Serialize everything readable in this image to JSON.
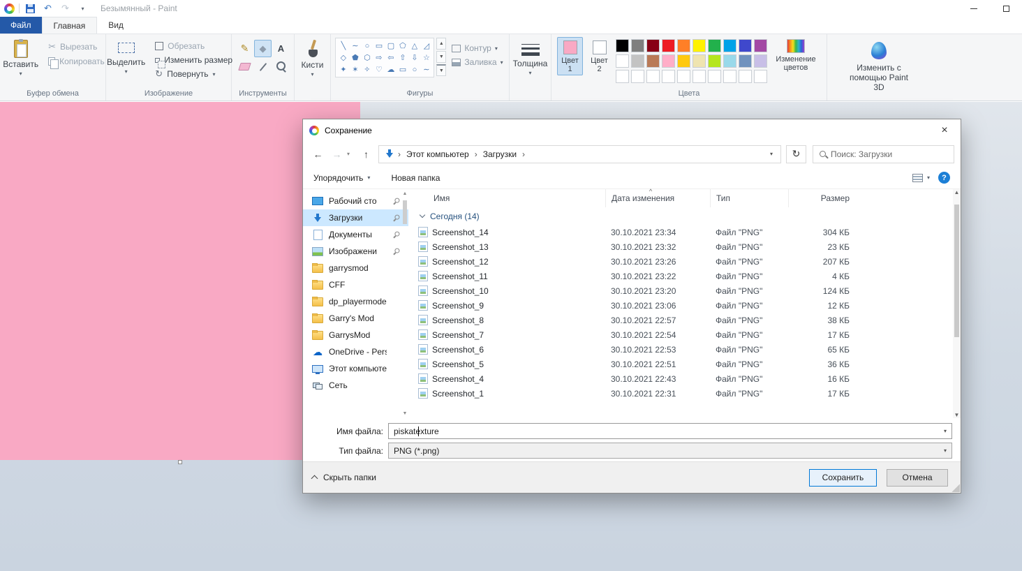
{
  "titlebar": {
    "title": "Безымянный - Paint"
  },
  "tabs": {
    "file": "Файл",
    "home": "Главная",
    "view": "Вид"
  },
  "ribbon": {
    "clipboard": {
      "label": "Буфер обмена",
      "paste": "Вставить",
      "cut": "Вырезать",
      "copy": "Копировать"
    },
    "image": {
      "label": "Изображение",
      "select": "Выделить",
      "crop": "Обрезать",
      "resize": "Изменить размер",
      "rotate": "Повернуть"
    },
    "tools": {
      "label": "Инструменты",
      "items": [
        {
          "icon": "pencil-icon"
        },
        {
          "icon": "fill-icon",
          "selected": true
        },
        {
          "icon": "text-icon"
        },
        {
          "icon": "eraser-icon"
        },
        {
          "icon": "picker-icon"
        },
        {
          "icon": "magnifier-icon"
        }
      ]
    },
    "brushes": {
      "label": "Кисти"
    },
    "shapes": {
      "label": "Фигуры",
      "outline": "Контур",
      "fill": "Заливка",
      "glyphs": [
        "╲",
        "∼",
        "○",
        "▭",
        "▢",
        "⬠",
        "△",
        "◿",
        "◇",
        "⬟",
        "⬡",
        "⇨",
        "⇦",
        "⇧",
        "⇩",
        "☆",
        "✦",
        "✶",
        "✧",
        "♡",
        "☁",
        "▭",
        "○",
        "∼"
      ]
    },
    "size": {
      "label": "Толщина"
    },
    "colors": {
      "label": "Цвета",
      "color1_label": "Цвет 1",
      "color2_label": "Цвет 2",
      "color1": "#f9a9c4",
      "color2": "#ffffff",
      "edit_label": "Изменение цветов",
      "palette": [
        "#000000",
        "#7f7f7f",
        "#880015",
        "#ed1c24",
        "#ff7f27",
        "#fff200",
        "#22b14c",
        "#00a2e8",
        "#3f48cc",
        "#a349a4",
        "#ffffff",
        "#c3c3c3",
        "#b97a57",
        "#ffaec8",
        "#ffc90e",
        "#efe4b0",
        "#b5e61d",
        "#99d9ea",
        "#7092be",
        "#c8bfe7",
        "",
        "",
        "",
        "",
        "",
        "",
        "",
        "",
        "",
        ""
      ]
    },
    "paint3d": {
      "label": "Изменить с помощью Paint 3D"
    }
  },
  "canvas": {
    "fill": "#f9a9c4"
  },
  "dialog": {
    "title": "Сохранение",
    "breadcrumb": {
      "items": [
        "Этот компьютер",
        "Загрузки"
      ]
    },
    "search_placeholder": "Поиск: Загрузки",
    "toolbar": {
      "organize": "Упорядочить",
      "new_folder": "Новая папка"
    },
    "sidebar": [
      {
        "label": "Рабочий сто",
        "icon": "desktop-icon",
        "pinned": true
      },
      {
        "label": "Загрузки",
        "icon": "downloads-icon",
        "pinned": true,
        "selected": true
      },
      {
        "label": "Документы",
        "icon": "documents-icon",
        "pinned": true
      },
      {
        "label": "Изображени",
        "icon": "pictures-icon",
        "pinned": true
      },
      {
        "label": "garrysmod",
        "icon": "folder-icon"
      },
      {
        "label": "CFF",
        "icon": "folder-icon"
      },
      {
        "label": "dp_playermodel",
        "icon": "folder-icon"
      },
      {
        "label": "Garry's Mod",
        "icon": "folder-icon"
      },
      {
        "label": "GarrysMod",
        "icon": "folder-icon"
      },
      {
        "label": "OneDrive - Person",
        "icon": "onedrive-icon"
      },
      {
        "label": "Этот компьютер",
        "icon": "computer-icon"
      },
      {
        "label": "Сеть",
        "icon": "network-icon"
      }
    ],
    "list": {
      "columns": {
        "name": "Имя",
        "date": "Дата изменения",
        "type": "Тип",
        "size": "Размер"
      },
      "group": "Сегодня (14)",
      "files": [
        {
          "name": "Screenshot_14",
          "date": "30.10.2021 23:34",
          "type": "Файл \"PNG\"",
          "size": "304 КБ"
        },
        {
          "name": "Screenshot_13",
          "date": "30.10.2021 23:32",
          "type": "Файл \"PNG\"",
          "size": "23 КБ"
        },
        {
          "name": "Screenshot_12",
          "date": "30.10.2021 23:26",
          "type": "Файл \"PNG\"",
          "size": "207 КБ"
        },
        {
          "name": "Screenshot_11",
          "date": "30.10.2021 23:22",
          "type": "Файл \"PNG\"",
          "size": "4 КБ"
        },
        {
          "name": "Screenshot_10",
          "date": "30.10.2021 23:20",
          "type": "Файл \"PNG\"",
          "size": "124 КБ"
        },
        {
          "name": "Screenshot_9",
          "date": "30.10.2021 23:06",
          "type": "Файл \"PNG\"",
          "size": "12 КБ"
        },
        {
          "name": "Screenshot_8",
          "date": "30.10.2021 22:57",
          "type": "Файл \"PNG\"",
          "size": "38 КБ"
        },
        {
          "name": "Screenshot_7",
          "date": "30.10.2021 22:54",
          "type": "Файл \"PNG\"",
          "size": "17 КБ"
        },
        {
          "name": "Screenshot_6",
          "date": "30.10.2021 22:53",
          "type": "Файл \"PNG\"",
          "size": "65 КБ"
        },
        {
          "name": "Screenshot_5",
          "date": "30.10.2021 22:51",
          "type": "Файл \"PNG\"",
          "size": "36 КБ"
        },
        {
          "name": "Screenshot_4",
          "date": "30.10.2021 22:43",
          "type": "Файл \"PNG\"",
          "size": "16 КБ"
        },
        {
          "name": "Screenshot_1",
          "date": "30.10.2021 22:31",
          "type": "Файл \"PNG\"",
          "size": "17 КБ"
        }
      ]
    },
    "filename": {
      "label": "Имя файла:",
      "value": "piskatexture"
    },
    "filetype": {
      "label": "Тип файла:",
      "value": "PNG (*.png)"
    },
    "footer": {
      "hide_folders": "Скрыть папки",
      "save": "Сохранить",
      "cancel": "Отмена"
    }
  }
}
